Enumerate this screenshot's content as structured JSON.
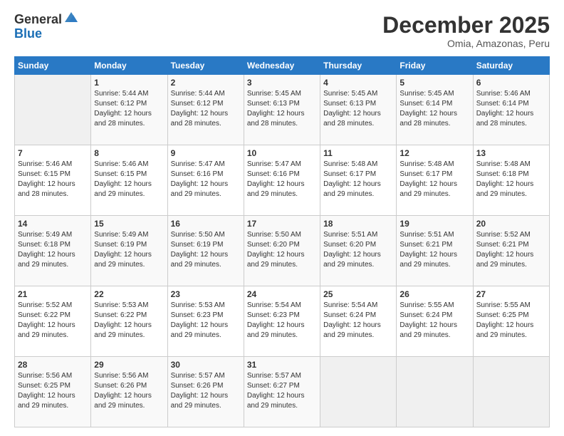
{
  "header": {
    "logo_general": "General",
    "logo_blue": "Blue",
    "month_title": "December 2025",
    "location": "Omia, Amazonas, Peru"
  },
  "days_of_week": [
    "Sunday",
    "Monday",
    "Tuesday",
    "Wednesday",
    "Thursday",
    "Friday",
    "Saturday"
  ],
  "weeks": [
    [
      {
        "day": "",
        "info": ""
      },
      {
        "day": "1",
        "info": "Sunrise: 5:44 AM\nSunset: 6:12 PM\nDaylight: 12 hours and 28 minutes."
      },
      {
        "day": "2",
        "info": "Sunrise: 5:44 AM\nSunset: 6:12 PM\nDaylight: 12 hours and 28 minutes."
      },
      {
        "day": "3",
        "info": "Sunrise: 5:45 AM\nSunset: 6:13 PM\nDaylight: 12 hours and 28 minutes."
      },
      {
        "day": "4",
        "info": "Sunrise: 5:45 AM\nSunset: 6:13 PM\nDaylight: 12 hours and 28 minutes."
      },
      {
        "day": "5",
        "info": "Sunrise: 5:45 AM\nSunset: 6:14 PM\nDaylight: 12 hours and 28 minutes."
      },
      {
        "day": "6",
        "info": "Sunrise: 5:46 AM\nSunset: 6:14 PM\nDaylight: 12 hours and 28 minutes."
      }
    ],
    [
      {
        "day": "7",
        "info": "Sunrise: 5:46 AM\nSunset: 6:15 PM\nDaylight: 12 hours and 28 minutes."
      },
      {
        "day": "8",
        "info": "Sunrise: 5:46 AM\nSunset: 6:15 PM\nDaylight: 12 hours and 29 minutes."
      },
      {
        "day": "9",
        "info": "Sunrise: 5:47 AM\nSunset: 6:16 PM\nDaylight: 12 hours and 29 minutes."
      },
      {
        "day": "10",
        "info": "Sunrise: 5:47 AM\nSunset: 6:16 PM\nDaylight: 12 hours and 29 minutes."
      },
      {
        "day": "11",
        "info": "Sunrise: 5:48 AM\nSunset: 6:17 PM\nDaylight: 12 hours and 29 minutes."
      },
      {
        "day": "12",
        "info": "Sunrise: 5:48 AM\nSunset: 6:17 PM\nDaylight: 12 hours and 29 minutes."
      },
      {
        "day": "13",
        "info": "Sunrise: 5:48 AM\nSunset: 6:18 PM\nDaylight: 12 hours and 29 minutes."
      }
    ],
    [
      {
        "day": "14",
        "info": "Sunrise: 5:49 AM\nSunset: 6:18 PM\nDaylight: 12 hours and 29 minutes."
      },
      {
        "day": "15",
        "info": "Sunrise: 5:49 AM\nSunset: 6:19 PM\nDaylight: 12 hours and 29 minutes."
      },
      {
        "day": "16",
        "info": "Sunrise: 5:50 AM\nSunset: 6:19 PM\nDaylight: 12 hours and 29 minutes."
      },
      {
        "day": "17",
        "info": "Sunrise: 5:50 AM\nSunset: 6:20 PM\nDaylight: 12 hours and 29 minutes."
      },
      {
        "day": "18",
        "info": "Sunrise: 5:51 AM\nSunset: 6:20 PM\nDaylight: 12 hours and 29 minutes."
      },
      {
        "day": "19",
        "info": "Sunrise: 5:51 AM\nSunset: 6:21 PM\nDaylight: 12 hours and 29 minutes."
      },
      {
        "day": "20",
        "info": "Sunrise: 5:52 AM\nSunset: 6:21 PM\nDaylight: 12 hours and 29 minutes."
      }
    ],
    [
      {
        "day": "21",
        "info": "Sunrise: 5:52 AM\nSunset: 6:22 PM\nDaylight: 12 hours and 29 minutes."
      },
      {
        "day": "22",
        "info": "Sunrise: 5:53 AM\nSunset: 6:22 PM\nDaylight: 12 hours and 29 minutes."
      },
      {
        "day": "23",
        "info": "Sunrise: 5:53 AM\nSunset: 6:23 PM\nDaylight: 12 hours and 29 minutes."
      },
      {
        "day": "24",
        "info": "Sunrise: 5:54 AM\nSunset: 6:23 PM\nDaylight: 12 hours and 29 minutes."
      },
      {
        "day": "25",
        "info": "Sunrise: 5:54 AM\nSunset: 6:24 PM\nDaylight: 12 hours and 29 minutes."
      },
      {
        "day": "26",
        "info": "Sunrise: 5:55 AM\nSunset: 6:24 PM\nDaylight: 12 hours and 29 minutes."
      },
      {
        "day": "27",
        "info": "Sunrise: 5:55 AM\nSunset: 6:25 PM\nDaylight: 12 hours and 29 minutes."
      }
    ],
    [
      {
        "day": "28",
        "info": "Sunrise: 5:56 AM\nSunset: 6:25 PM\nDaylight: 12 hours and 29 minutes."
      },
      {
        "day": "29",
        "info": "Sunrise: 5:56 AM\nSunset: 6:26 PM\nDaylight: 12 hours and 29 minutes."
      },
      {
        "day": "30",
        "info": "Sunrise: 5:57 AM\nSunset: 6:26 PM\nDaylight: 12 hours and 29 minutes."
      },
      {
        "day": "31",
        "info": "Sunrise: 5:57 AM\nSunset: 6:27 PM\nDaylight: 12 hours and 29 minutes."
      },
      {
        "day": "",
        "info": ""
      },
      {
        "day": "",
        "info": ""
      },
      {
        "day": "",
        "info": ""
      }
    ]
  ]
}
